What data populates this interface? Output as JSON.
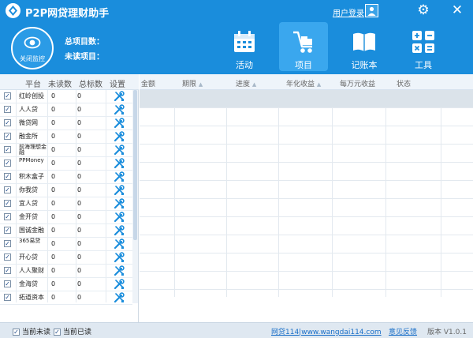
{
  "app": {
    "title": "P2P网贷理财助手"
  },
  "titlebar": {
    "login": "用户登录"
  },
  "header": {
    "monitor_label": "关闭监控",
    "total_projects_label": "总项目数：",
    "unread_projects_label": "未读项目：",
    "nav": [
      {
        "label": "活动",
        "icon": "calendar-icon"
      },
      {
        "label": "项目",
        "icon": "cart-icon",
        "active": true
      },
      {
        "label": "记账本",
        "icon": "book-icon"
      },
      {
        "label": "工具",
        "icon": "calculator-icon"
      }
    ]
  },
  "platforms": {
    "headers": {
      "platform": "平台",
      "unread": "未读数",
      "total": "总标数",
      "settings": "设置"
    },
    "rows": [
      {
        "name": "红岭创投",
        "unread": "0",
        "total": "0"
      },
      {
        "name": "人人贷",
        "unread": "0",
        "total": "0"
      },
      {
        "name": "微贷网",
        "unread": "0",
        "total": "0"
      },
      {
        "name": "融金所",
        "unread": "0",
        "total": "0"
      },
      {
        "name": "前海理想金融",
        "unread": "0",
        "total": "0"
      },
      {
        "name": "PPMoney",
        "unread": "0",
        "total": "0"
      },
      {
        "name": "积木盒子",
        "unread": "0",
        "total": "0"
      },
      {
        "name": "你我贷",
        "unread": "0",
        "total": "0"
      },
      {
        "name": "宜人贷",
        "unread": "0",
        "total": "0"
      },
      {
        "name": "金开贷",
        "unread": "0",
        "total": "0"
      },
      {
        "name": "国诚金融",
        "unread": "0",
        "total": "0"
      },
      {
        "name": "365易贷",
        "unread": "0",
        "total": "0"
      },
      {
        "name": "开心贷",
        "unread": "0",
        "total": "0"
      },
      {
        "name": "人人聚财",
        "unread": "0",
        "total": "0"
      },
      {
        "name": "金海贷",
        "unread": "0",
        "total": "0"
      },
      {
        "name": "拓道资本",
        "unread": "0",
        "total": "0"
      }
    ]
  },
  "projects": {
    "headers": {
      "amount": "金额",
      "term": "期限",
      "progress": "进度",
      "rate": "年化收益",
      "per_10k": "每万元收益",
      "status": "状态"
    }
  },
  "footer": {
    "show_unread": "当前未读",
    "show_read": "当前已读",
    "site": "网贷114|www.wangdai114.com",
    "feedback": "意见反馈",
    "version": "版本 V1.0.1"
  }
}
